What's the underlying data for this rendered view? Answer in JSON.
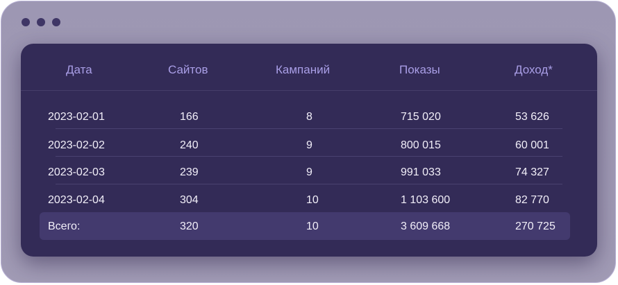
{
  "table": {
    "headers": [
      "Дата",
      "Сайтов",
      "Кампаний",
      "Показы",
      "Доход*"
    ],
    "rows": [
      [
        "2023-02-01",
        "166",
        "8",
        "715 020",
        "53 626"
      ],
      [
        "2023-02-02",
        "240",
        "9",
        "800 015",
        "60 001"
      ],
      [
        "2023-02-03",
        "239",
        "9",
        "991 033",
        "74 327"
      ],
      [
        "2023-02-04",
        "304",
        "10",
        "1 103 600",
        "82 770"
      ]
    ],
    "total": [
      "Всего:",
      "320",
      "10",
      "3 609 668",
      "270 725"
    ]
  },
  "colors": {
    "window_bg": "#9d97b3",
    "panel_bg": "#332b57",
    "header_text": "#a99ee6",
    "total_row_bg": "#433a6e",
    "dot": "#3f3666"
  }
}
